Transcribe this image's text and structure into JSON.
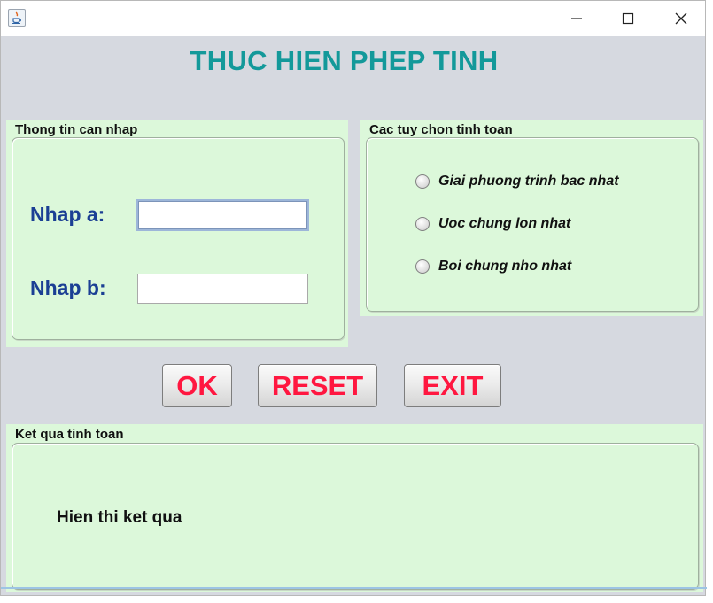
{
  "window": {
    "controls": {
      "minimize": "minimize-icon",
      "maximize": "maximize-icon",
      "close": "close-icon"
    }
  },
  "header": {
    "title": "THUC HIEN PHEP TINH"
  },
  "input_panel": {
    "title": "Thong tin can nhap",
    "fields": [
      {
        "label": "Nhap a:",
        "value": "",
        "focused": true
      },
      {
        "label": "Nhap b:",
        "value": "",
        "focused": false
      }
    ]
  },
  "options_panel": {
    "title": "Cac tuy chon tinh toan",
    "options": [
      {
        "label": "Giai phuong trinh bac nhat",
        "selected": false
      },
      {
        "label": "Uoc chung lon nhat",
        "selected": false
      },
      {
        "label": "Boi chung nho nhat",
        "selected": false
      }
    ]
  },
  "buttons": {
    "ok": "OK",
    "reset": "RESET",
    "exit": "EXIT"
  },
  "result_panel": {
    "title": "Ket qua tinh toan",
    "text": "Hien thi ket qua"
  },
  "colors": {
    "title": "#13999a",
    "panel_background": "#dcf8da",
    "window_background": "#d6d9e0",
    "field_label": "#1b3f94",
    "button_text": "#ff1740"
  }
}
